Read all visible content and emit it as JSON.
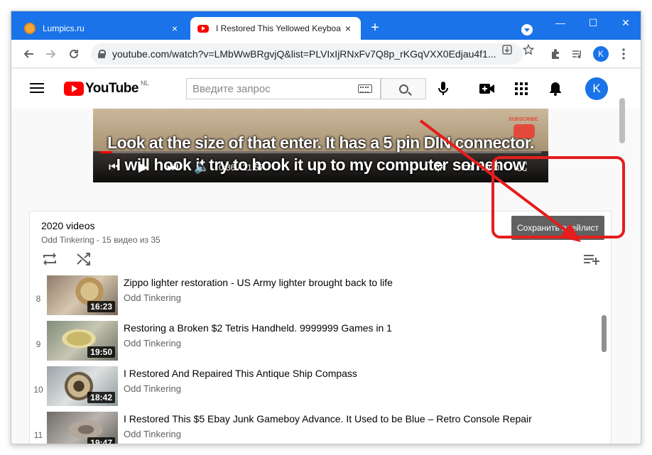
{
  "browser": {
    "tabs": [
      {
        "title": "Lumpics.ru",
        "close": "×"
      },
      {
        "title": "I Restored This Yellowed Keyboa",
        "close": "×"
      }
    ],
    "new_tab": "+",
    "window_controls": {
      "minimize": "—",
      "maximize": "☐",
      "close": "✕"
    },
    "url": "youtube.com/watch?v=LMbWwBRgvjQ&list=PLVIxIjRNxFv7Q8p_rKGqVXX0Edjau4f1...",
    "profile_letter": "K"
  },
  "youtube": {
    "logo_text": "YouTube",
    "region": "NL",
    "search_placeholder": "Введите запрос",
    "avatar_letter": "K"
  },
  "video": {
    "caption_line1": "Look at the size of that enter. It has a 5 pin DIN connector.",
    "caption_line2": "I will hook it try to hook it up to my computer somehow",
    "time": "0:36 / 21:57",
    "subscribe_text": "SUBSCRIBE",
    "progress_fraction": 0.027
  },
  "playlist": {
    "title": "2020 videos",
    "channel": "Odd Tinkering",
    "count_text": " - 15 видео из 35",
    "tooltip": "Сохранить плейлист",
    "items": [
      {
        "index": "8",
        "title": "Zippo lighter restoration - US Army lighter brought back to life",
        "channel": "Odd Tinkering",
        "duration": "16:23"
      },
      {
        "index": "9",
        "title": "Restoring a Broken $2 Tetris Handheld. 9999999 Games in 1",
        "channel": "Odd Tinkering",
        "duration": "19:50"
      },
      {
        "index": "10",
        "title": "I Restored And Repaired This Antique Ship Compass",
        "channel": "Odd Tinkering",
        "duration": "18:42"
      },
      {
        "index": "11",
        "title": "I Restored This $5 Ebay Junk Gameboy Advance. It Used to be Blue – Retro Console Repair",
        "channel": "Odd Tinkering",
        "duration": "19:47"
      }
    ]
  },
  "colors": {
    "chrome_blue": "#1a73e8",
    "youtube_red": "#ff0000",
    "annotation_red": "#e51d1d"
  }
}
